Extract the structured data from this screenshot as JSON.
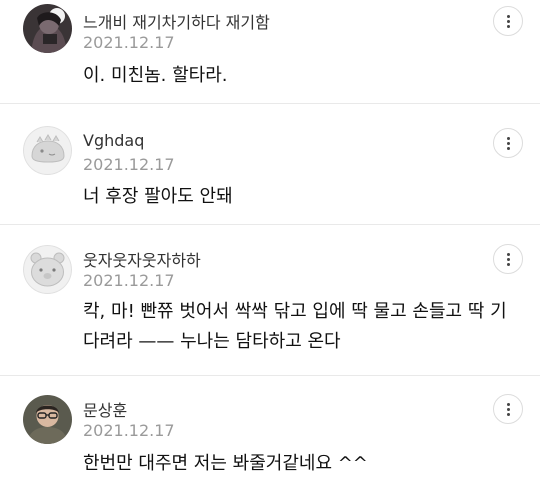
{
  "comments": [
    {
      "author": "느개비 재기차기하다 재기함",
      "date": "2021.12.17",
      "text": "이. 미친놈. 할타라.",
      "avatar_icon": "dark-portrait-avatar"
    },
    {
      "author": "Vghdaq",
      "date": "2021.12.17",
      "text": "너 후장 팔아도 안돼",
      "avatar_icon": "grey-creature-avatar"
    },
    {
      "author": "웃자웃자웃자하하",
      "date": "2021.12.17",
      "text": "칵, 마! 빤쮸 벗어서 싹싹 닦고 입에 딱 물고 손들고 딱 기다려라 —— 누나는 담타하고 온다",
      "avatar_icon": "grey-bear-avatar"
    },
    {
      "author": "문상훈",
      "date": "2021.12.17",
      "text": "한번만 대주면 저는 봐줄거같네요 ^^",
      "avatar_icon": "photo-portrait-avatar"
    }
  ],
  "more_icon": "vertical-ellipsis-icon",
  "colors": {
    "author": "#333333",
    "date": "#9a9a9a",
    "divider": "#e9e9e9",
    "text": "#111111"
  }
}
